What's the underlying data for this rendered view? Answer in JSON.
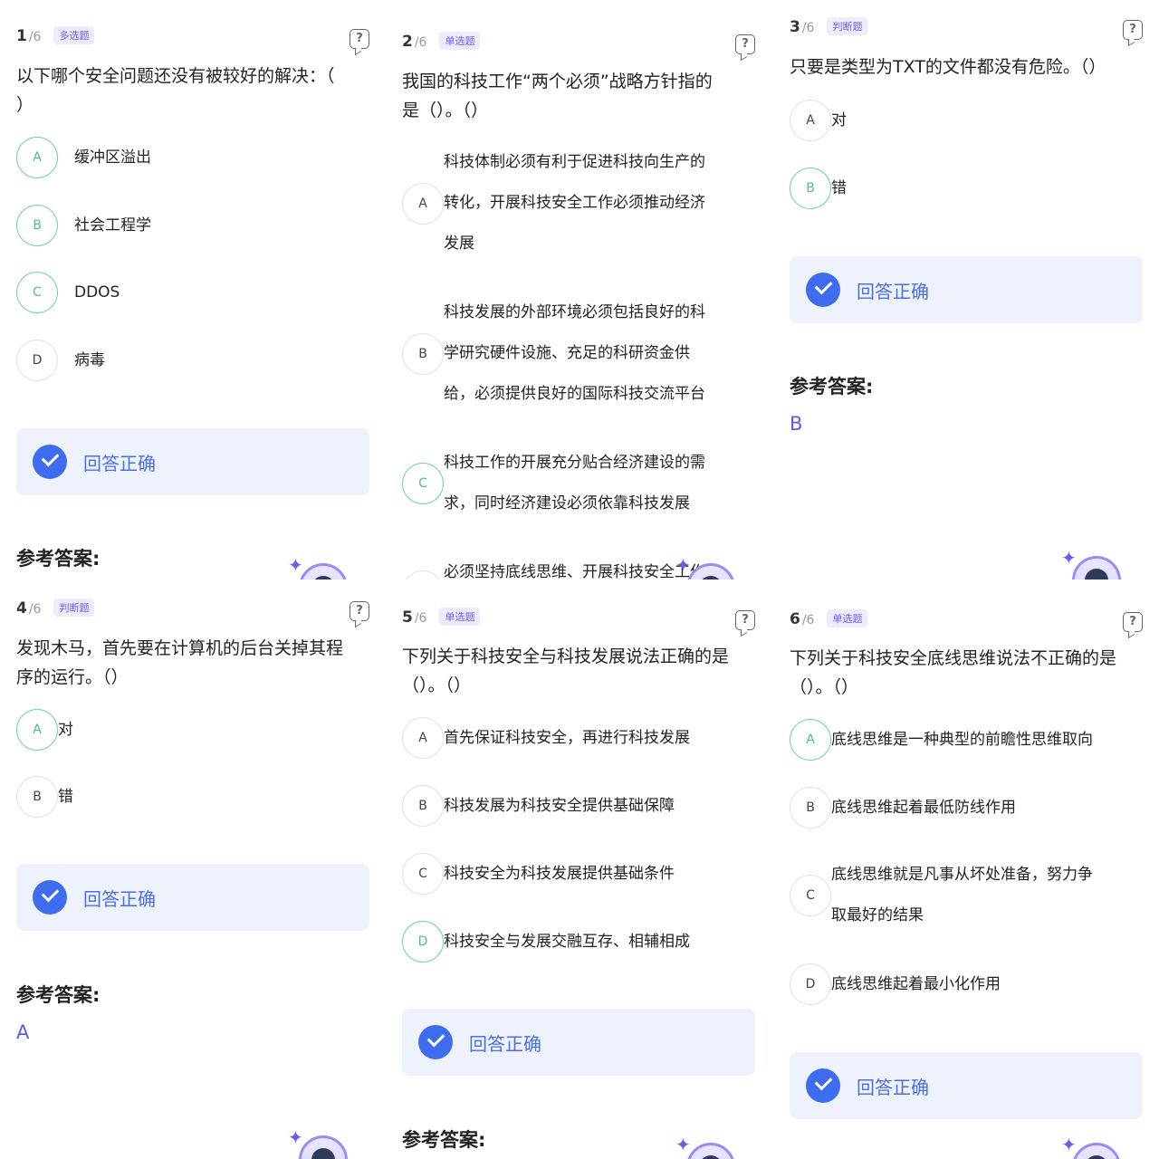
{
  "total": "6",
  "result_label": "回答正确",
  "answer_title": "参考答案:",
  "questions": [
    {
      "num": "1",
      "of": "/6",
      "type": "多选题",
      "text": [
        "以下哪个安全问题还没有被较好的解决：（",
        "）"
      ],
      "options": [
        {
          "key": "A",
          "text": "缓冲区溢出"
        },
        {
          "key": "B",
          "text": "社会工程学"
        },
        {
          "key": "C",
          "text": "DDOS"
        },
        {
          "key": "D",
          "text": "病毒"
        }
      ],
      "answer": ""
    },
    {
      "num": "2",
      "of": "/6",
      "type": "单选题",
      "text": [
        "我国的科技工作“两个必须”战略方针指的",
        "是（）。（）"
      ],
      "options": [
        {
          "key": "A",
          "text": [
            "科技体制必须有利于促进科技向生产的",
            "转化，开展科技安全工作必须推动经济",
            "发展"
          ]
        },
        {
          "key": "B",
          "text": [
            "科技发展的外部环境必须包括良好的科",
            "学研究硬件设施、充足的科研资金供",
            "给，必须提供良好的国际科技交流平台"
          ]
        },
        {
          "key": "C",
          "text": [
            "科技工作的开展充分贴合经济建设的需",
            "求，同时经济建设必须依靠科技发展"
          ]
        },
        {
          "key": "D",
          "text": [
            "必须坚持底线思维、开展科技安全工作"
          ]
        }
      ],
      "answer": ""
    },
    {
      "num": "3",
      "of": "/6",
      "type": "判断题",
      "text": [
        "只要是类型为TXT的文件都没有危险。（）"
      ],
      "options": [
        {
          "key": "A",
          "text": "对"
        },
        {
          "key": "B",
          "text": "错"
        }
      ],
      "answer": "B"
    },
    {
      "num": "4",
      "of": "/6",
      "type": "判断题",
      "text": [
        "发现木马，首先要在计算机的后台关掉其程",
        "序的运行。（）"
      ],
      "options": [
        {
          "key": "A",
          "text": "对"
        },
        {
          "key": "B",
          "text": "错"
        }
      ],
      "answer": "A"
    },
    {
      "num": "5",
      "of": "/6",
      "type": "单选题",
      "text": [
        "下列关于科技安全与科技发展说法正确的是",
        "（）。（）"
      ],
      "options": [
        {
          "key": "A",
          "text": "首先保证科技安全，再进行科技发展"
        },
        {
          "key": "B",
          "text": "科技发展为科技安全提供基础保障"
        },
        {
          "key": "C",
          "text": "科技安全为科技发展提供基础条件"
        },
        {
          "key": "D",
          "text": "科技安全与发展交融互存、相辅相成"
        }
      ],
      "answer": ""
    },
    {
      "num": "6",
      "of": "/6",
      "type": "单选题",
      "text": [
        "下列关于科技安全底线思维说法不正确的是",
        "（）。（）"
      ],
      "options": [
        {
          "key": "A",
          "text": "底线思维是一种典型的前瞻性思维取向"
        },
        {
          "key": "B",
          "text": "底线思维起着最低防线作用"
        },
        {
          "key": "C",
          "text": [
            "底线思维就是凡事从坏处准备，努力争",
            "取最好的结果"
          ]
        },
        {
          "key": "D",
          "text": "底线思维起着最小化作用"
        }
      ],
      "answer": ""
    }
  ]
}
